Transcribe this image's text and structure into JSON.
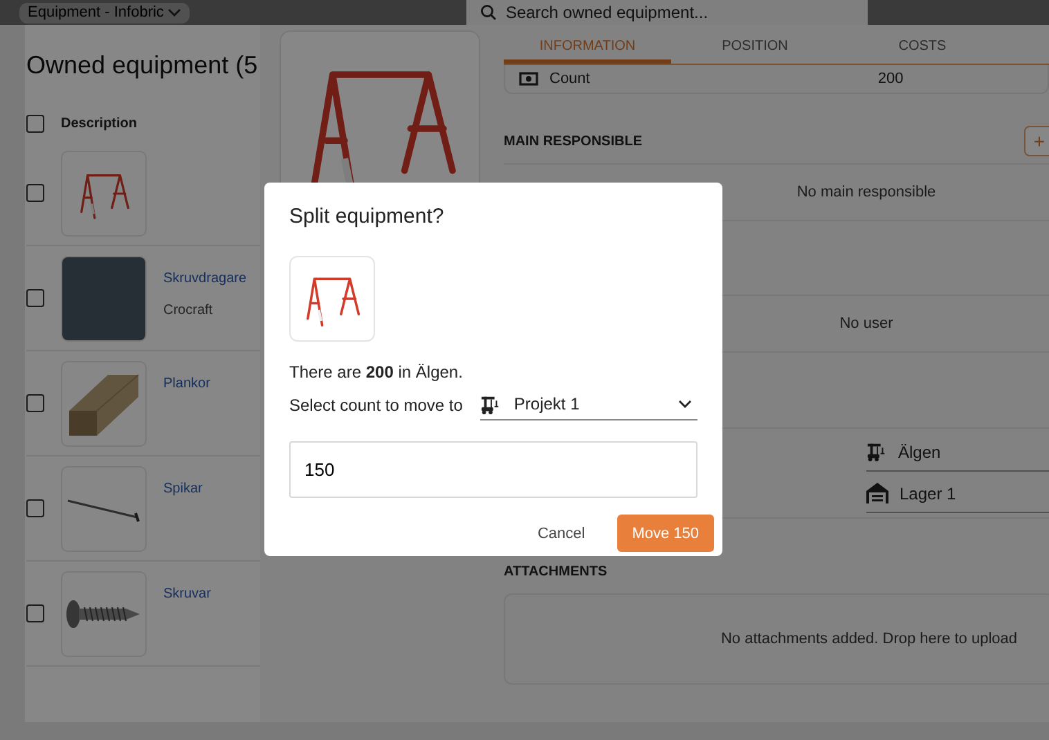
{
  "top_bar": {
    "breadcrumb": "Equipment - Infobric",
    "search": {
      "placeholder": "Search owned equipment..."
    }
  },
  "equipment_list": {
    "title": "Owned equipment (5",
    "column": "Description",
    "all_checked": false,
    "rows": [
      {
        "kind": "frame",
        "checked": false
      },
      {
        "kind": "photo",
        "name": "Skruvdragare",
        "brand": "Crocraft",
        "checked": false
      },
      {
        "kind": "plank",
        "name": "Plankor",
        "checked": false
      },
      {
        "kind": "nail",
        "name": "Spikar",
        "checked": false
      },
      {
        "kind": "screw",
        "name": "Skruvar",
        "checked": false
      }
    ]
  },
  "drawer": {
    "tabs": [
      {
        "label": "INFORMATION",
        "selected": true
      },
      {
        "label": "POSITION",
        "selected": false
      },
      {
        "label": "COSTS",
        "selected": false
      }
    ],
    "count": {
      "label": "Count",
      "value": "200"
    },
    "main_responsible": {
      "heading": "MAIN RESPONSIBLE",
      "add_button": "+",
      "empty": "No main responsible"
    },
    "user": {
      "empty": "No user"
    },
    "positions": [
      {
        "kind": "site",
        "name": "Älgen"
      },
      {
        "kind": "warehouse",
        "name": "Lager 1"
      }
    ],
    "attachments": {
      "heading": "ATTACHMENTS",
      "empty": "No attachments added. Drop here to upload"
    }
  },
  "dialog": {
    "title": "Split equipment?",
    "message": "There are **200** in Älgen.",
    "select_label": "Select count to move to",
    "destination": {
      "kind": "site",
      "value": "Projekt 1"
    },
    "count_value": "150",
    "buttons": [
      {
        "kind": "text",
        "label": "Cancel"
      },
      {
        "kind": "primary",
        "label": "Move 150"
      }
    ]
  }
}
